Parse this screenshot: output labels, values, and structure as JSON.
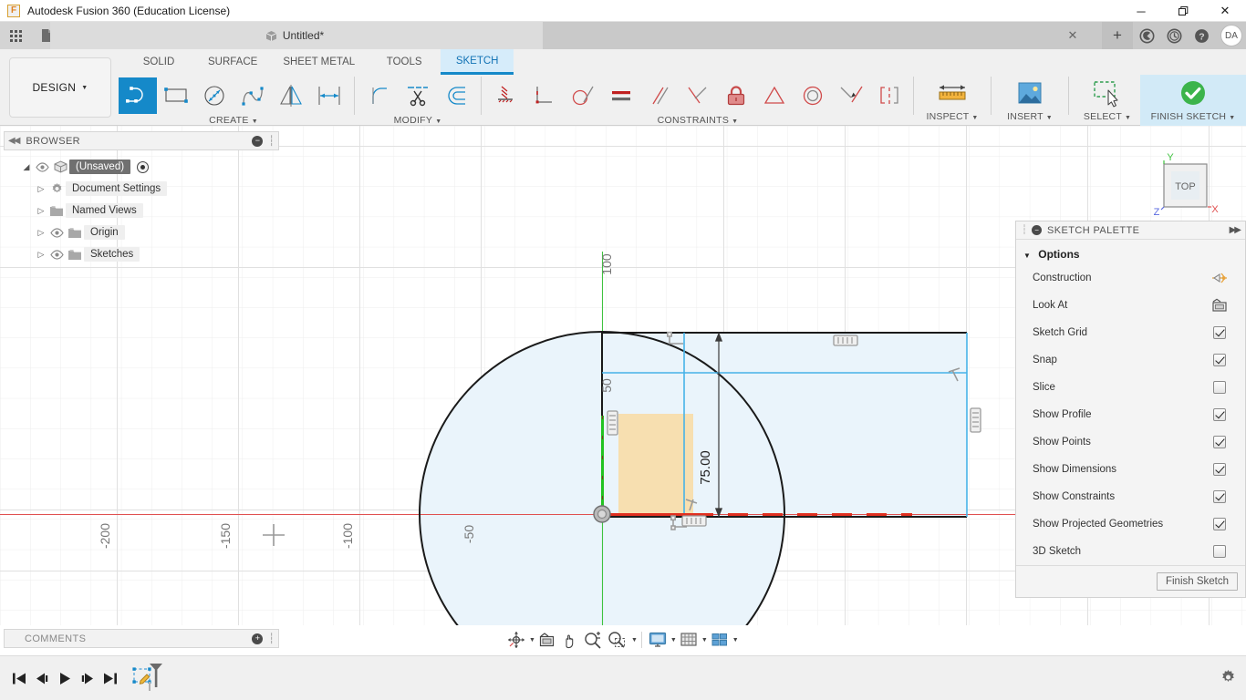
{
  "window": {
    "title": "Autodesk Fusion 360 (Education License)",
    "minimize": "─",
    "maximize": "❐",
    "close": "✕"
  },
  "quick_access": {
    "grid_icon": "grid-icon",
    "new_icon": "new-document-icon",
    "save_icon": "save-icon",
    "undo_icon": "undo-icon",
    "redo_icon": "redo-icon",
    "document_tab": "Untitled*",
    "tab_close": "✕",
    "new_tab": "+",
    "job_status_icon": "job-status-icon",
    "recent_icon": "recent-icon",
    "help_icon": "help-icon",
    "avatar_initials": "DA"
  },
  "ribbon": {
    "workspace": "DESIGN",
    "workspace_caret": "▼",
    "tabs": [
      {
        "label": "SOLID",
        "active": false
      },
      {
        "label": "SURFACE",
        "active": false
      },
      {
        "label": "SHEET METAL",
        "active": false
      },
      {
        "label": "TOOLS",
        "active": false
      },
      {
        "label": "SKETCH",
        "active": true
      }
    ],
    "groups": [
      {
        "label": "CREATE",
        "caret": "▼",
        "tools": [
          "line-tool-icon",
          "rectangle-tool-icon",
          "circle-tool-icon",
          "spline-tool-icon",
          "mirror-tool-icon",
          "dimension-tool-icon"
        ]
      },
      {
        "label": "MODIFY",
        "caret": "▼",
        "tools": [
          "fillet-tool-icon",
          "trim-tool-icon",
          "offset-tool-icon"
        ]
      },
      {
        "label": "CONSTRAINTS",
        "caret": "▼",
        "tools": [
          "horizontal-vertical-constraint-icon",
          "perpendicular-constraint-icon",
          "tangent-constraint-icon",
          "equal-constraint-icon",
          "parallel-constraint-icon",
          "coincident-constraint-icon",
          "fix-constraint-icon",
          "midpoint-constraint-icon",
          "concentric-constraint-icon",
          "collinear-constraint-icon",
          "symmetry-constraint-icon"
        ]
      }
    ],
    "right_groups": [
      {
        "label": "INSPECT",
        "caret": "▼",
        "icon": "measure-icon",
        "highlight": false
      },
      {
        "label": "INSERT",
        "caret": "▼",
        "icon": "insert-image-icon",
        "highlight": false
      },
      {
        "label": "SELECT",
        "caret": "▼",
        "icon": "select-window-icon",
        "highlight": false
      },
      {
        "label": "FINISH SKETCH",
        "caret": "▼",
        "icon": "finish-sketch-check-icon",
        "highlight": true
      }
    ]
  },
  "browser": {
    "title": "BROWSER",
    "collapse_icon": "collapse-left-icon",
    "minimize_icon": "−",
    "grip_icon": "panel-grip-icon",
    "items": [
      {
        "label": "(Unsaved)",
        "root": true,
        "arrow": "◢",
        "eye": true,
        "icon": "component-cube-icon",
        "radio": true
      },
      {
        "label": "Document Settings",
        "root": false,
        "arrow": "▷",
        "eye": false,
        "icon": "gear-icon",
        "radio": false
      },
      {
        "label": "Named Views",
        "root": false,
        "arrow": "▷",
        "eye": false,
        "icon": "folder-icon",
        "radio": false
      },
      {
        "label": "Origin",
        "root": false,
        "arrow": "▷",
        "eye": true,
        "icon": "folder-icon",
        "radio": false
      },
      {
        "label": "Sketches",
        "root": false,
        "arrow": "▷",
        "eye": true,
        "icon": "folder-icon",
        "radio": false
      }
    ]
  },
  "sketch_palette": {
    "title": "SKETCH PALETTE",
    "grip_icon": "panel-grip-icon",
    "minimize_icon": "−",
    "expand_icon": "expand-right-icon",
    "section_title": "Options",
    "section_caret": "▼",
    "rows": [
      {
        "label": "Construction",
        "control": "icon",
        "icon": "construction-geometry-icon",
        "checked": false
      },
      {
        "label": "Look At",
        "control": "icon",
        "icon": "look-at-icon",
        "checked": false
      },
      {
        "label": "Sketch Grid",
        "control": "checkbox",
        "checked": true
      },
      {
        "label": "Snap",
        "control": "checkbox",
        "checked": true
      },
      {
        "label": "Slice",
        "control": "checkbox",
        "checked": false
      },
      {
        "label": "Show Profile",
        "control": "checkbox",
        "checked": true
      },
      {
        "label": "Show Points",
        "control": "checkbox",
        "checked": true
      },
      {
        "label": "Show Dimensions",
        "control": "checkbox",
        "checked": true
      },
      {
        "label": "Show Constraints",
        "control": "checkbox",
        "checked": true
      },
      {
        "label": "Show Projected Geometries",
        "control": "checkbox",
        "checked": true
      },
      {
        "label": "3D Sketch",
        "control": "checkbox",
        "checked": false
      }
    ],
    "finish_button": "Finish Sketch"
  },
  "canvas": {
    "viewcube_label": "TOP",
    "axis_x_label": "X",
    "axis_y_label": "Y",
    "axis_z_label": "Z",
    "ruler_labels_horizontal": [
      "-200",
      "-150",
      "-100",
      "-50"
    ],
    "ruler_labels_vertical": [
      "100",
      "50"
    ],
    "dimension_value": "75.00",
    "origin_marker": "origin-point-icon",
    "colors": {
      "profile_fill": "#eaf4fb",
      "selected_fill": "#f7dfb0",
      "projected_geometry": "#46b2e8",
      "x_axis": "#e05050",
      "y_axis": "#2fbf2f",
      "sketch_curve": "#1a1a1a",
      "accent": "#1589c9"
    }
  },
  "comments": {
    "title": "COMMENTS",
    "add_icon": "+",
    "grip_icon": "panel-grip-icon"
  },
  "navbar": {
    "buttons": [
      {
        "icon": "orbit-icon",
        "caret": true
      },
      {
        "icon": "look-at-icon",
        "caret": false
      },
      {
        "icon": "pan-icon",
        "caret": false
      },
      {
        "icon": "zoom-icon",
        "caret": false
      },
      {
        "icon": "zoom-window-icon",
        "caret": true
      },
      {
        "icon": "display-settings-icon",
        "caret": true
      },
      {
        "icon": "grid-snaps-icon",
        "caret": true
      },
      {
        "icon": "viewports-icon",
        "caret": true
      }
    ]
  },
  "timeline": {
    "buttons": [
      "jump-to-beginning-icon",
      "step-back-icon",
      "play-icon",
      "step-forward-icon",
      "jump-to-end-icon"
    ],
    "feature_icon": "sketch-feature-icon",
    "settings_icon": "gear-icon"
  }
}
